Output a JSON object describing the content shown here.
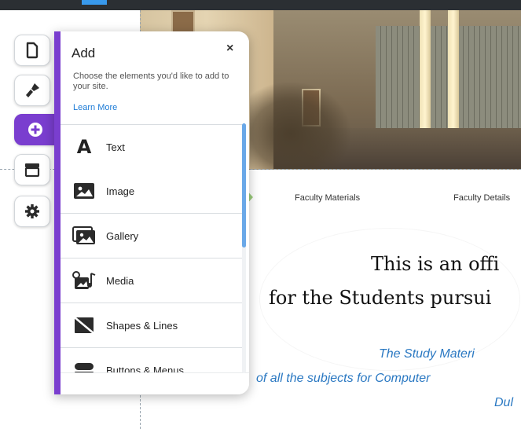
{
  "site": {
    "nav": {
      "item1": "Faculty Materials",
      "item2": "Faculty Details"
    },
    "headline": {
      "line1": "This is an offi",
      "line2": "for the Students pursui"
    },
    "subtext": {
      "line1": "The Study Materi",
      "line2": "of all the subjects for Computer",
      "line3": "Dul"
    }
  },
  "rail": {
    "buttons": [
      {
        "icon": "page-icon"
      },
      {
        "icon": "paintbrush-icon"
      },
      {
        "icon": "add-icon",
        "active": true
      },
      {
        "icon": "store-icon"
      },
      {
        "icon": "gear-icon"
      }
    ]
  },
  "panel": {
    "title": "Add",
    "close_label": "×",
    "description": "Choose the elements you'd like to add to your site.",
    "learn_more": "Learn More",
    "items": [
      {
        "label": "Text",
        "icon": "text-icon"
      },
      {
        "label": "Image",
        "icon": "image-icon"
      },
      {
        "label": "Gallery",
        "icon": "gallery-icon"
      },
      {
        "label": "Media",
        "icon": "media-icon"
      },
      {
        "label": "Shapes & Lines",
        "icon": "shapes-icon"
      },
      {
        "label": "Buttons & Menus",
        "icon": "buttons-icon"
      }
    ]
  },
  "colors": {
    "accent": "#7a3ecf",
    "link": "#1d7bd6",
    "scrollbar": "#6aa8e8",
    "site_text_blue": "#2a78c2"
  }
}
